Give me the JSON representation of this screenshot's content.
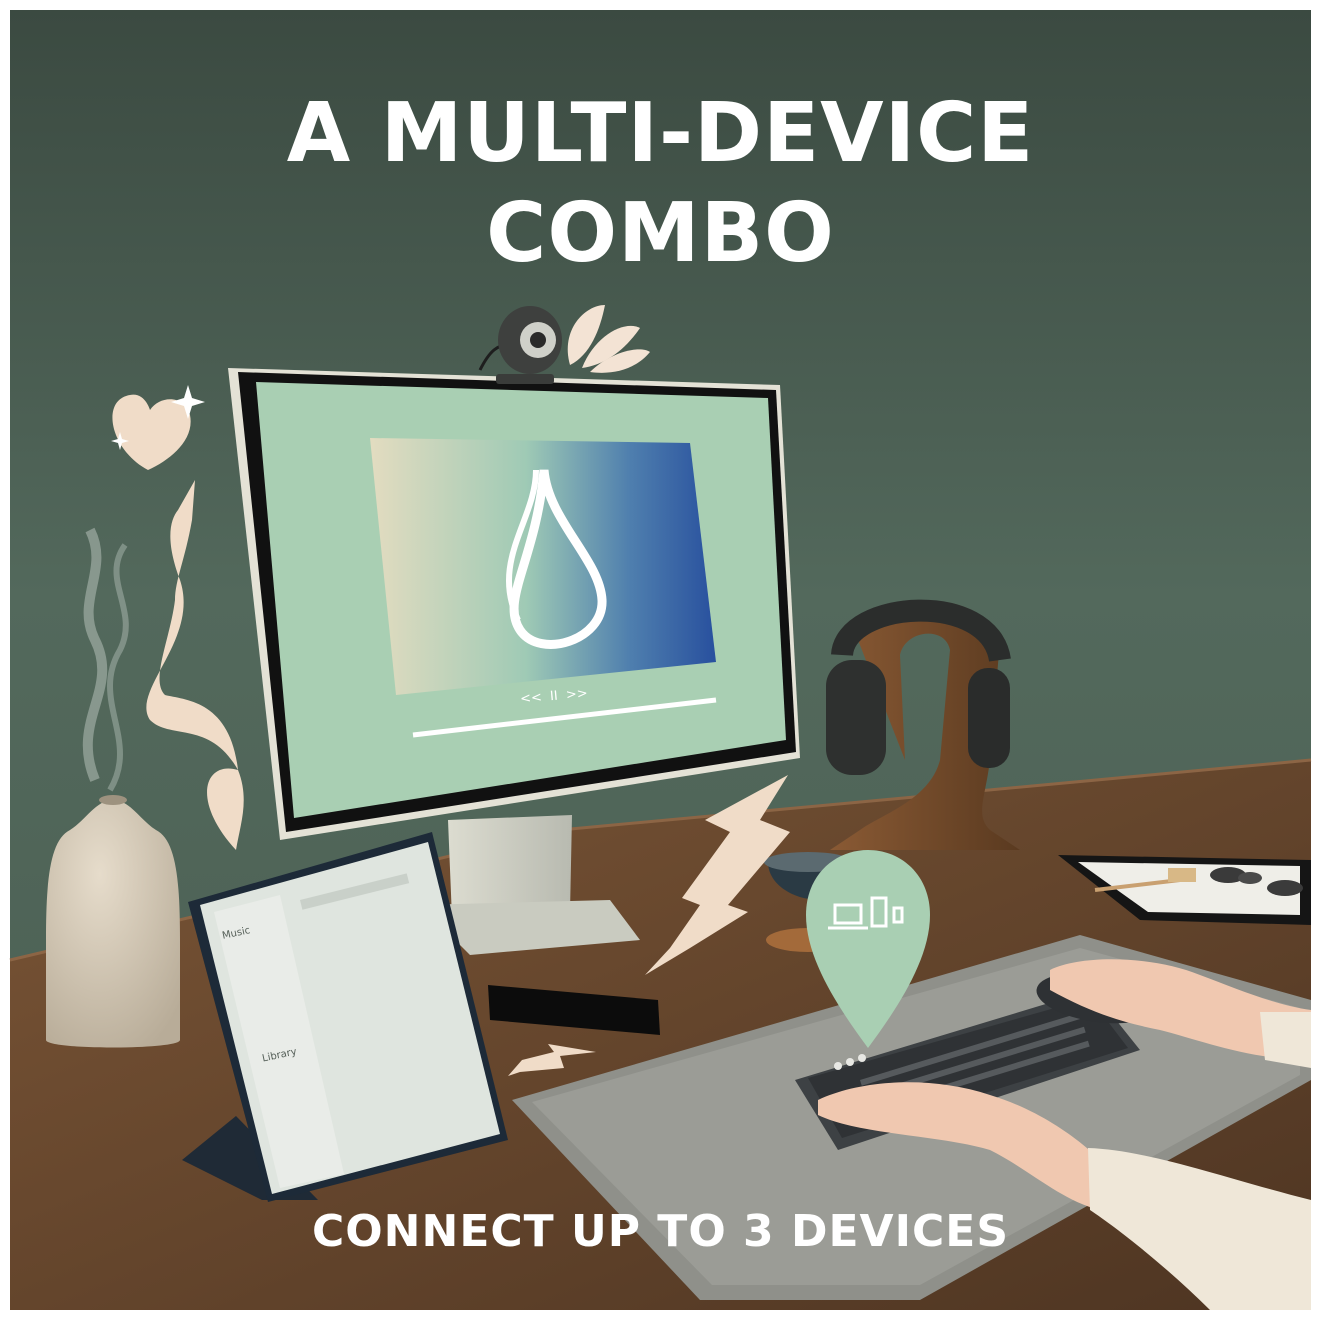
{
  "headline": {
    "line1": "A MULTI-DEVICE",
    "line2": "COMBO"
  },
  "tagline": "CONNECT UP TO 3 DEVICES",
  "monitor_screen": {
    "player_controls": "<<  II  >>"
  },
  "tablet_screen": {
    "sidebar_title": "Music",
    "library_title": "Library"
  },
  "colors": {
    "wall": "#4e6358",
    "desk": "#6a4a30",
    "mint": "#a9cfb3",
    "accent_cream": "#f0dcc8",
    "white_text": "#ffffff"
  },
  "icons": {
    "pin": "multi-device-icon",
    "heart": "heart-icon"
  }
}
